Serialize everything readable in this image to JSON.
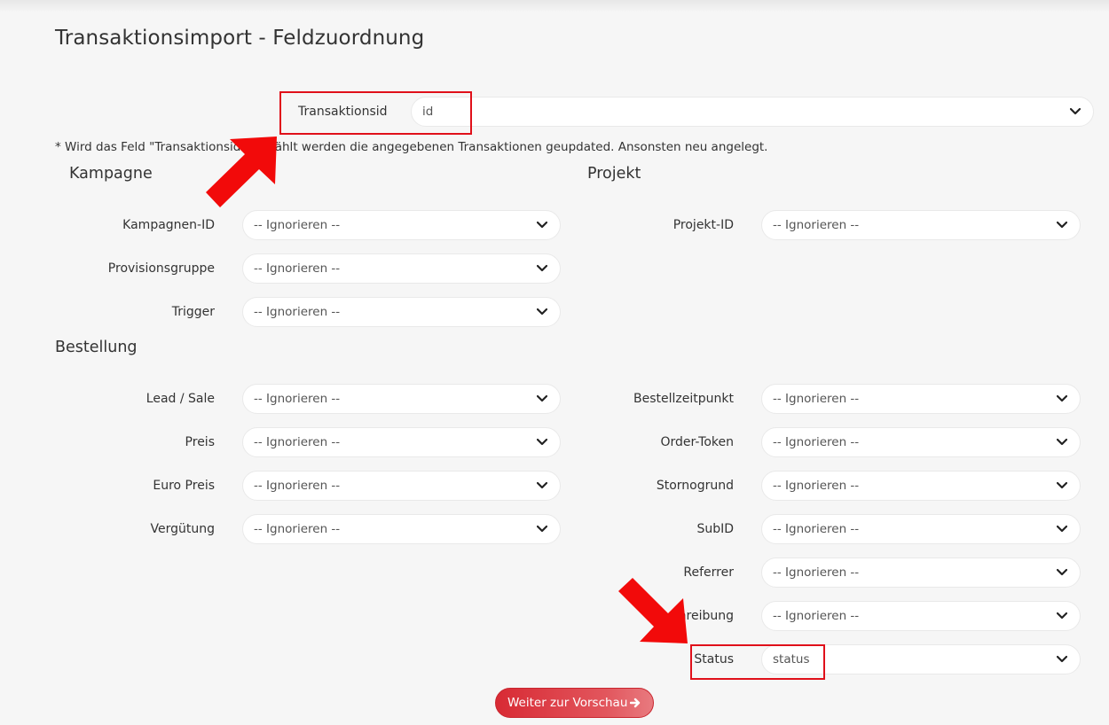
{
  "page": {
    "title": "Transaktionsimport - Feldzuordnung"
  },
  "transaction_id": {
    "label": "Transaktionsid",
    "value": "id"
  },
  "note": "* Wird das Feld \"Transaktionsid\" gewählt werden die angegebenen Transaktionen geupdated. Ansonsten neu angelegt.",
  "sections": {
    "kampagne": "Kampagne",
    "projekt": "Projekt",
    "bestellung": "Bestellung"
  },
  "default_option": "-- Ignorieren --",
  "kampagne_fields": [
    {
      "label": "Kampagnen-ID",
      "value": "-- Ignorieren --"
    },
    {
      "label": "Provisionsgruppe",
      "value": "-- Ignorieren --"
    },
    {
      "label": "Trigger",
      "value": "-- Ignorieren --"
    }
  ],
  "projekt_fields": [
    {
      "label": "Projekt-ID",
      "value": "-- Ignorieren --"
    }
  ],
  "bestellung_left": [
    {
      "label": "Lead / Sale",
      "value": "-- Ignorieren --"
    },
    {
      "label": "Preis",
      "value": "-- Ignorieren --"
    },
    {
      "label": "Euro Preis",
      "value": "-- Ignorieren --"
    },
    {
      "label": "Vergütung",
      "value": "-- Ignorieren --"
    }
  ],
  "bestellung_right": [
    {
      "label": "Bestellzeitpunkt",
      "value": "-- Ignorieren --"
    },
    {
      "label": "Order-Token",
      "value": "-- Ignorieren --"
    },
    {
      "label": "Stornogrund",
      "value": "-- Ignorieren --"
    },
    {
      "label": "SubID",
      "value": "-- Ignorieren --"
    },
    {
      "label": "Referrer",
      "value": "-- Ignorieren --"
    },
    {
      "label": "hreibung",
      "value": "-- Ignorieren --"
    },
    {
      "label": "Status",
      "value": "status"
    }
  ],
  "button": {
    "label": "Weiter zur Vorschau",
    "icon": "arrow-right-icon"
  },
  "annotations": {
    "highlight_color": "#e0101a",
    "arrow_color": "#f20a0a"
  },
  "colors": {
    "accent": "#d82a34",
    "background": "#f6f6f6"
  }
}
